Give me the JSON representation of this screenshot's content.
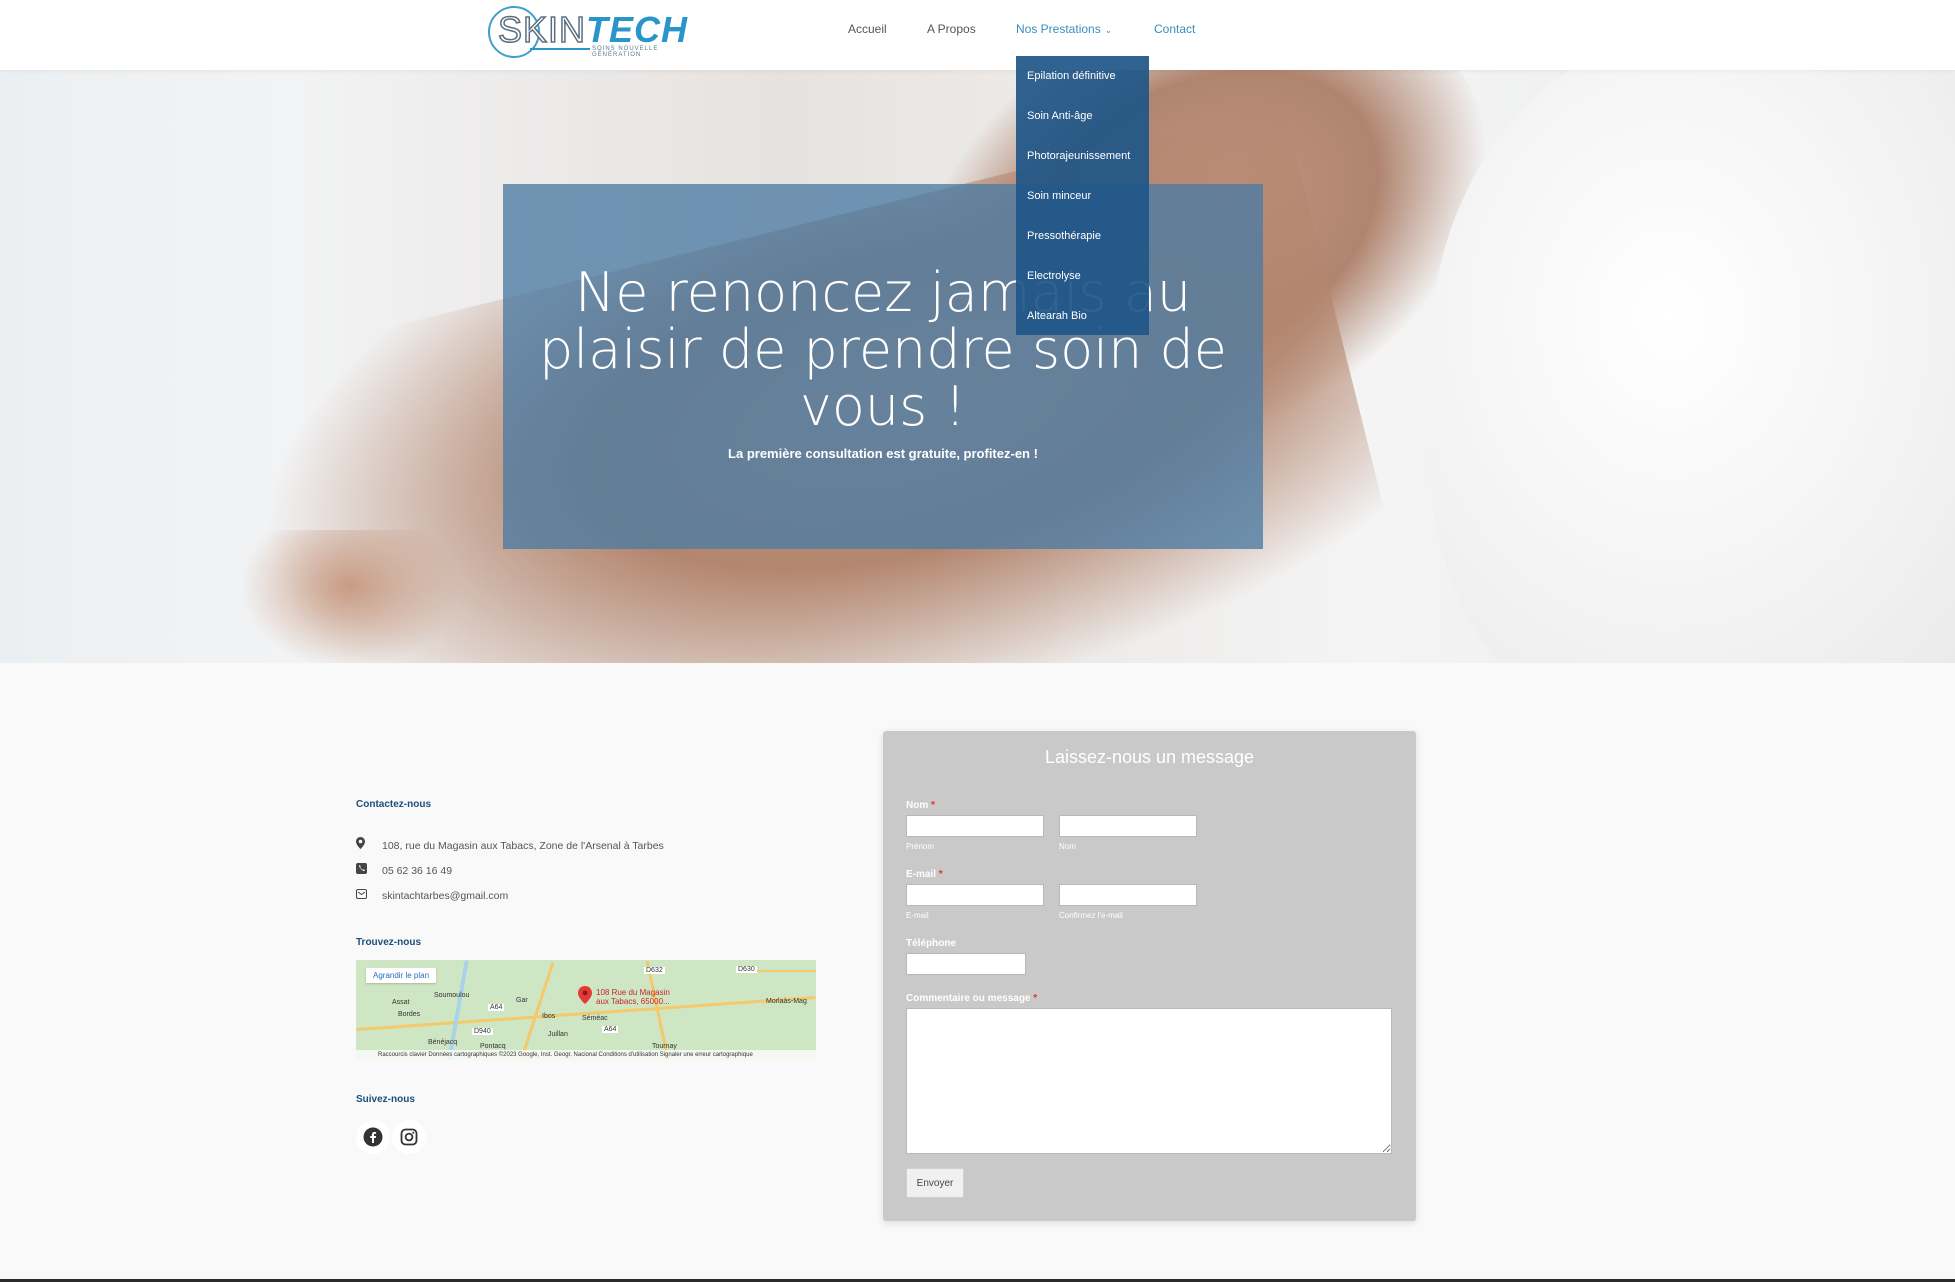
{
  "header": {
    "logo_text": "SKINTECH",
    "logo_tagline": "SOINS NOUVELLE GÉNÉRATION",
    "nav": {
      "accueil": "Accueil",
      "apropos": "A Propos",
      "prestations": "Nos Prestations",
      "contact": "Contact"
    }
  },
  "dropdown": {
    "items": [
      "Epilation définitive",
      "Soin Anti-âge",
      "Photorajeunissement",
      "Soin minceur",
      "Pressothérapie",
      "Electrolyse",
      "Altearah Bio"
    ]
  },
  "hero": {
    "title": "Ne renoncez jamais au plaisir de prendre soin de vous !",
    "subtitle": "La première consultation est gratuite, profitez-en !"
  },
  "contact": {
    "heading": "Contactez-nous",
    "address": "108, rue du Magasin aux Tabacs, Zone de l'Arsenal à Tarbes",
    "phone": "05 62 36 16 49",
    "email": "skintachtarbes@gmail.com",
    "find_heading": "Trouvez-nous",
    "follow_heading": "Suivez-nous"
  },
  "map": {
    "enlarge": "Agrandir le plan",
    "pin_label_1": "108 Rue du Magasin",
    "pin_label_2": "aux Tabacs, 65000...",
    "places": [
      "Soumoulou",
      "Assat",
      "Bordes",
      "Gar",
      "Ibos",
      "Séméac",
      "Juillan",
      "Bénéjacq",
      "Pontacq",
      "Morlaàs-Mag",
      "Tournay"
    ],
    "roads": [
      "D632",
      "D630",
      "A64",
      "D940",
      "A64"
    ],
    "footer": "Raccourcis clavier   Données cartographiques ©2023 Google, Inst. Geogr. Nacional   Conditions d'utilisation   Signaler une erreur cartographique"
  },
  "form": {
    "title": "Laissez-nous un message",
    "nom_label": "Nom",
    "prenom_sub": "Prénom",
    "nom_sub": "Nom",
    "email_label": "E-mail",
    "email_sub": "E-mail",
    "confirm_sub": "Confirmez l'e-mail",
    "phone_label": "Téléphone",
    "comment_label": "Commentaire ou message",
    "required": "*",
    "submit": "Envoyer"
  },
  "colors": {
    "accent": "#2a95c9",
    "hero_overlay": "#4c7ba3",
    "dropdown_bg": "#1f5688",
    "form_bg": "#c9c9c9"
  }
}
